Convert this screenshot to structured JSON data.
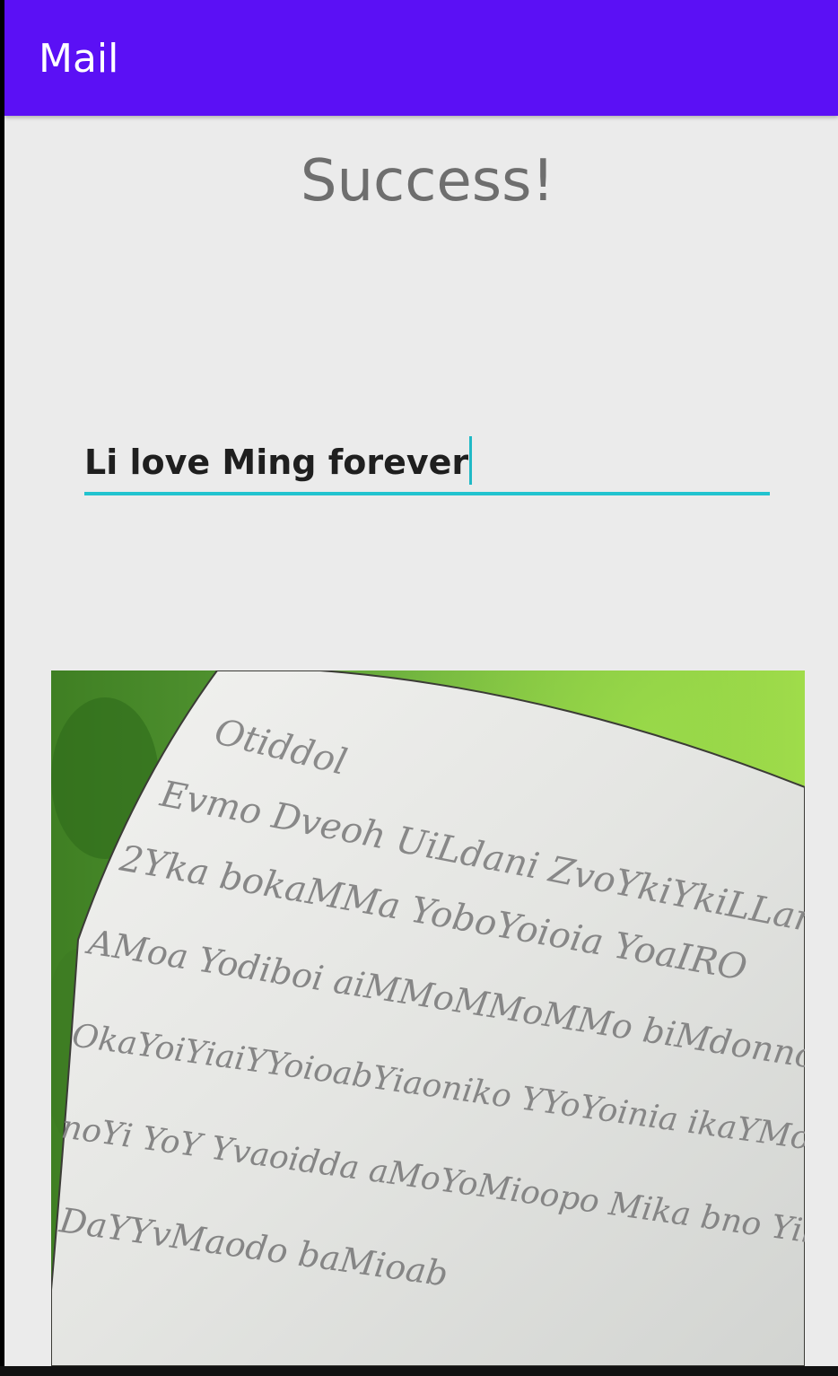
{
  "app_bar": {
    "title": "Mail",
    "color": "#5b10f5"
  },
  "status": {
    "message": "Success!"
  },
  "message_field": {
    "value": "Li love Ming forever",
    "accent_color": "#22c3cf"
  },
  "photo": {
    "description_icon": "letter-photo",
    "handwriting_lines": [
      "Otiddol",
      "Evmo Dveoh UiLdani ZvoYkiYkiLLan",
      "2Yka bokaMMa YoboYoioia YoaIRO",
      "AMoa Yodiboi aiMMoMMoMMo biMdonnoMMo aaaoMa",
      "OkaYoiYiaiYYoioabYiaoniko YYoYoinia ikaYMoa oMa",
      "noYi YoY Yvaoidda aMoYoMioopo Mika bno Yika baoika",
      "DaYYvMaodo baMioab"
    ]
  }
}
